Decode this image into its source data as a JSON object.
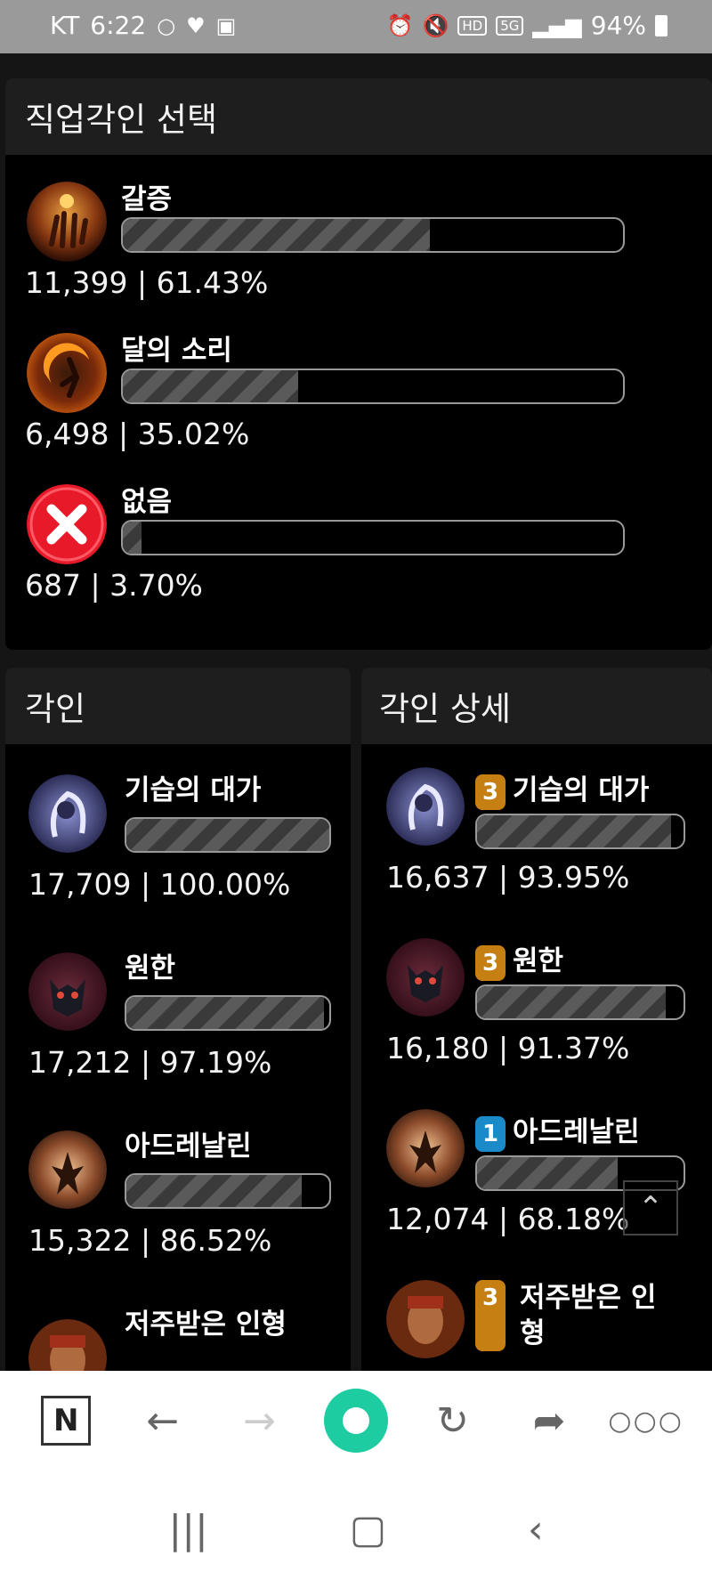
{
  "status_bar": {
    "carrier": "KT",
    "time": "6:22",
    "battery": "94%",
    "hd_label": "HD",
    "net_label": "5G"
  },
  "class_panel": {
    "title": "직업각인 선택",
    "items": [
      {
        "name": "갈증",
        "count": "11,399 | 61.43%",
        "percent": 61.43
      },
      {
        "name": "달의 소리",
        "count": "6,498 | 35.02%",
        "percent": 35.02
      },
      {
        "name": "없음",
        "count": "687 | 3.70%",
        "percent": 3.7
      }
    ]
  },
  "engraving_panel": {
    "title": "각인",
    "items": [
      {
        "name": "기습의 대가",
        "count": "17,709 | 100.00%",
        "percent": 100.0
      },
      {
        "name": "원한",
        "count": "17,212 | 97.19%",
        "percent": 97.19
      },
      {
        "name": "아드레날린",
        "count": "15,322 | 86.52%",
        "percent": 86.52
      },
      {
        "name": "저주받은 인형"
      }
    ]
  },
  "detail_panel": {
    "title": "각인 상세",
    "items": [
      {
        "level": "3",
        "name": "기습의 대가",
        "count": "16,637 | 93.95%",
        "percent": 93.95,
        "level_color": "#c57f12"
      },
      {
        "level": "3",
        "name": "원한",
        "count": "16,180 | 91.37%",
        "percent": 91.37,
        "level_color": "#c57f12"
      },
      {
        "level": "1",
        "name": "아드레날린",
        "count": "12,074 | 68.18%",
        "percent": 68.18,
        "level_color": "#1b8ac9"
      },
      {
        "level": "3",
        "name": "저주받은 인",
        "name2": "형",
        "level_color": "#c57f12"
      }
    ]
  },
  "colors": {
    "accent_green": "#1dcca0",
    "level_orange": "#c57f12",
    "level_blue": "#1b8ac9"
  }
}
